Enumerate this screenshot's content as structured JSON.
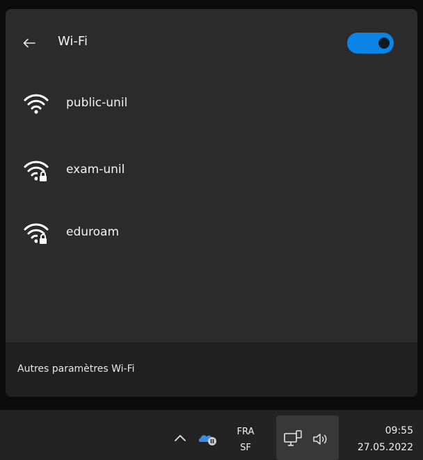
{
  "flyout": {
    "title": "Wi-Fi",
    "wifi_enabled": true,
    "accent_color": "#0a84e6",
    "networks": [
      {
        "name": "public-unil",
        "icon": "wifi-open-icon",
        "secured": false
      },
      {
        "name": "exam-unil",
        "icon": "wifi-secured-icon",
        "secured": true
      },
      {
        "name": "eduroam",
        "icon": "wifi-secured-icon",
        "secured": true
      }
    ],
    "footer_link": "Autres paramètres Wi-Fi"
  },
  "taskbar": {
    "lang_line1": "FRA",
    "lang_line2": "SF",
    "time": "09:55",
    "date": "27.05.2022"
  }
}
